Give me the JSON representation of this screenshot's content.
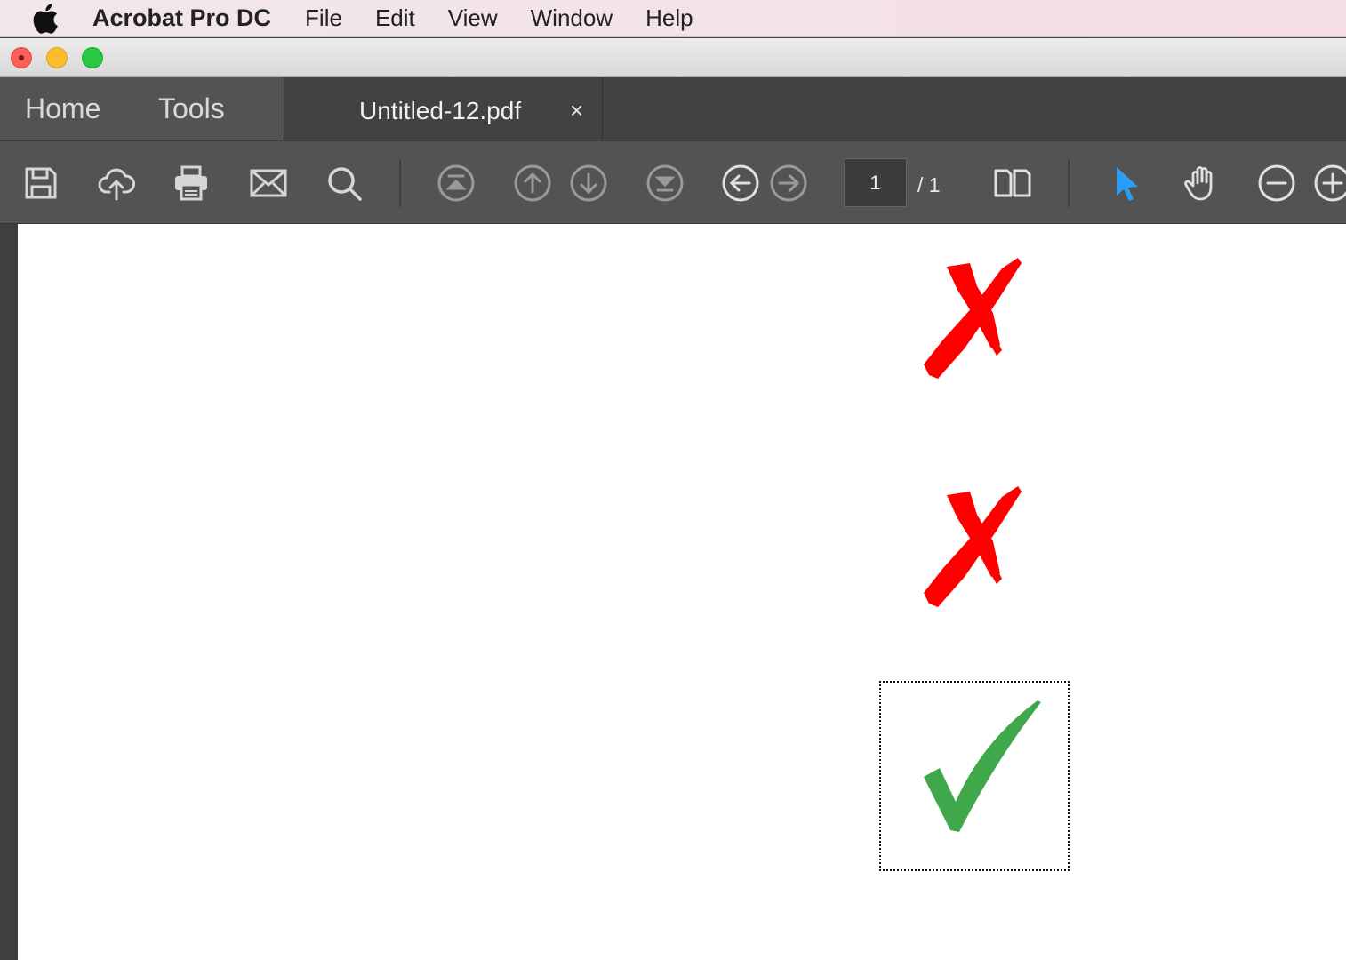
{
  "menubar": {
    "app_name": "Acrobat Pro DC",
    "items": [
      "File",
      "Edit",
      "View",
      "Window",
      "Help"
    ]
  },
  "tabs": {
    "home": "Home",
    "tools": "Tools",
    "document": "Untitled-12.pdf",
    "close_symbol": "×"
  },
  "toolbar": {
    "current_page": "1",
    "total_pages": "/ 1"
  },
  "colors": {
    "cross_mark": "#ff0000",
    "check_mark": "#3fa84a",
    "select_tool_active": "#2a9df4"
  },
  "icons": [
    "save-icon",
    "upload-cloud-icon",
    "print-icon",
    "email-icon",
    "search-icon",
    "first-page-icon",
    "previous-page-icon",
    "next-page-icon",
    "last-page-icon",
    "back-icon",
    "forward-icon",
    "page-view-icon",
    "select-cursor-icon",
    "hand-icon",
    "zoom-out-icon",
    "zoom-in-icon"
  ]
}
